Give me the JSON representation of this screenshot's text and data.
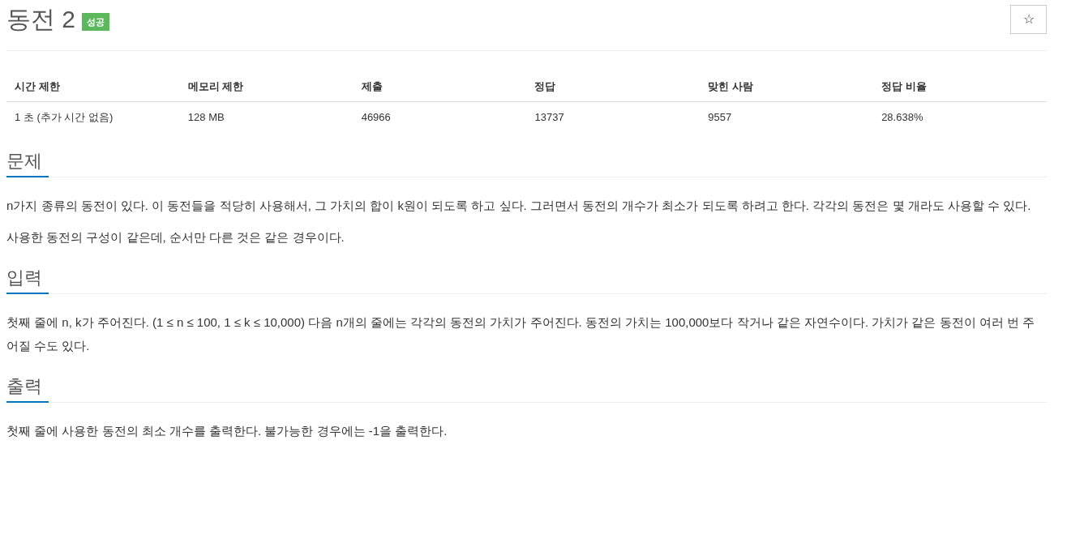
{
  "title": "동전 2",
  "result_badge": "성공",
  "star_button": "☆",
  "table": {
    "columns": [
      "시간 제한",
      "메모리 제한",
      "제출",
      "정답",
      "맞힌 사람",
      "정답 비율"
    ],
    "rows": [
      [
        "1 초 (추가 시간 없음)",
        "128 MB",
        "46966",
        "13737",
        "9557",
        "28.638%"
      ]
    ]
  },
  "sections": [
    {
      "heading": "문제",
      "paragraphs": [
        "n가지 종류의 동전이 있다. 이 동전들을 적당히 사용해서, 그 가치의 합이 k원이 되도록 하고 싶다. 그러면서 동전의 개수가 최소가 되도록 하려고 한다. 각각의 동전은 몇 개라도 사용할 수 있다.",
        "사용한 동전의 구성이 같은데, 순서만 다른 것은 같은 경우이다."
      ]
    },
    {
      "heading": "입력",
      "paragraphs": [
        "첫째 줄에 n, k가 주어진다. (1 ≤ n ≤ 100, 1 ≤ k ≤ 10,000) 다음 n개의 줄에는 각각의 동전의 가치가 주어진다. 동전의 가치는 100,000보다 작거나 같은 자연수이다. 가치가 같은 동전이 여러 번 주어질 수도 있다."
      ]
    },
    {
      "heading": "출력",
      "paragraphs": [
        "첫째 줄에 사용한 동전의 최소 개수를 출력한다. 불가능한 경우에는 -1을 출력한다."
      ]
    }
  ]
}
